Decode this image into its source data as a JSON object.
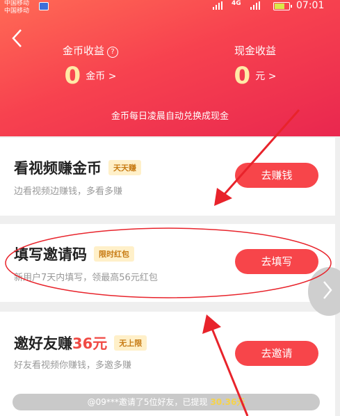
{
  "status_bar": {
    "carrier_1": "中国移动",
    "carrier_2": "中国移动",
    "network": "4G",
    "time": "07:01"
  },
  "header": {
    "coin_income_label": "金币收益",
    "coin_value": "0",
    "coin_unit": "金币 >",
    "cash_income_label": "现金收益",
    "cash_value": "0",
    "cash_unit": "元 >",
    "note": "金币每日凌晨自动兑换成现金",
    "help_icon": "?"
  },
  "tasks": [
    {
      "title": "看视频赚金币",
      "badge": "天天赚",
      "subtitle": "边看视频边赚钱，多看多赚",
      "button": "去赚钱"
    },
    {
      "title": "填写邀请码",
      "badge": "限时红包",
      "subtitle": "新用户7天内填写，领最高56元红包",
      "button": "去填写"
    },
    {
      "title": "邀好友赚",
      "title_amount": "36元",
      "badge": "无上限",
      "subtitle": "好友看视频你赚钱，多邀多赚",
      "button": "去邀请"
    }
  ],
  "invite_ticker": {
    "text": "@09***邀请了5位好友，已提现 ",
    "amount": "30.36元"
  },
  "colors": {
    "accent": "#f7454a",
    "header_start": "#ff6a55",
    "header_end": "#e9274f",
    "annotation": "#e8232b"
  },
  "icons": [
    "back-icon",
    "help-icon",
    "chevron-right-icon",
    "battery-icon",
    "signal-icon"
  ]
}
